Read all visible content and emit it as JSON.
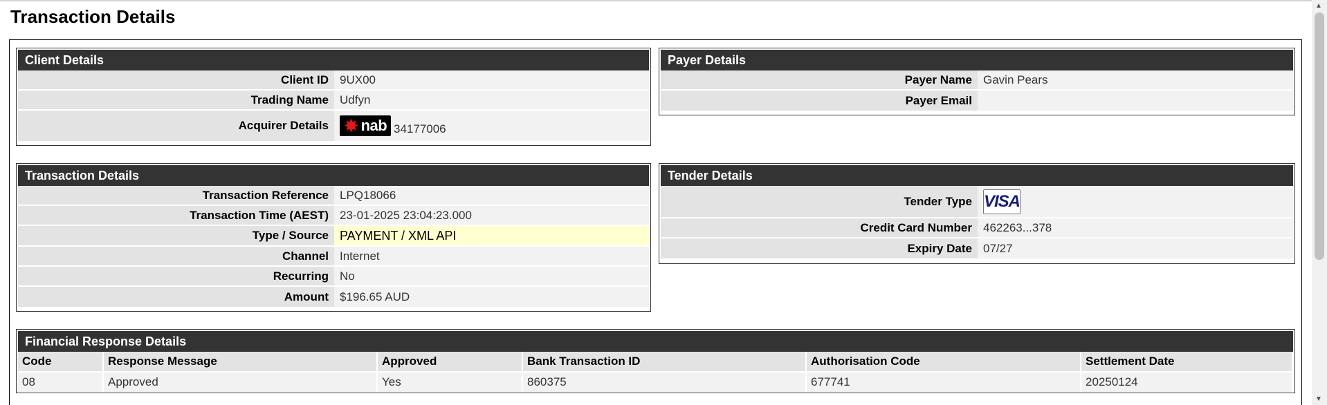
{
  "page": {
    "title": "Transaction Details"
  },
  "client_details": {
    "header": "Client Details",
    "rows": [
      {
        "label": "Client ID",
        "value": "9UX00"
      },
      {
        "label": "Trading Name",
        "value": "Udfyn"
      },
      {
        "label": "Acquirer Details",
        "value": "34177006",
        "logo_text": "nab",
        "logo_icon": "nab-star-logo"
      }
    ]
  },
  "payer_details": {
    "header": "Payer Details",
    "rows": [
      {
        "label": "Payer Name",
        "value": "Gavin Pears"
      },
      {
        "label": "Payer Email",
        "value": ""
      }
    ]
  },
  "transaction_details": {
    "header": "Transaction Details",
    "rows": [
      {
        "label": "Transaction Reference",
        "value": "LPQ18066"
      },
      {
        "label": "Transaction Time (AEST)",
        "value": "23-01-2025 23:04:23.000"
      },
      {
        "label": "Type / Source",
        "value": "PAYMENT / XML API",
        "highlight_color": "#ffffd0"
      },
      {
        "label": "Channel",
        "value": "Internet"
      },
      {
        "label": "Recurring",
        "value": "No"
      },
      {
        "label": "Amount",
        "value": "$196.65 AUD"
      }
    ]
  },
  "tender_details": {
    "header": "Tender Details",
    "rows": [
      {
        "label": "Tender Type",
        "value": "VISA",
        "logo_icon": "visa-logo"
      },
      {
        "label": "Credit Card Number",
        "value": "462263...378"
      },
      {
        "label": "Expiry Date",
        "value": "07/27"
      }
    ]
  },
  "financial_response": {
    "header": "Financial Response Details",
    "columns": [
      "Code",
      "Response Message",
      "Approved",
      "Bank Transaction ID",
      "Authorisation Code",
      "Settlement Date"
    ],
    "rows": [
      [
        "08",
        "Approved",
        "Yes",
        "860375",
        "677741",
        "20250124"
      ]
    ]
  },
  "colors": {
    "header_bg": "#333333",
    "label_bg": "#e3e3e3",
    "value_bg": "#f2f2f2",
    "highlight_bg": "#ffffd0"
  }
}
